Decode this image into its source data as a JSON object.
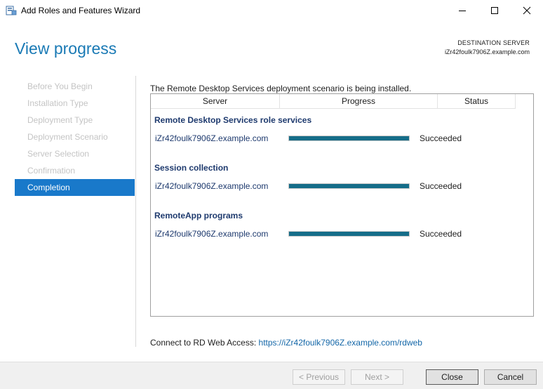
{
  "window": {
    "title": "Add Roles and Features Wizard",
    "icon": "server-manager-icon"
  },
  "header": {
    "title": "View progress",
    "destination_label": "DESTINATION SERVER",
    "destination_server": "iZr42foulk7906Z.example.com"
  },
  "nav": {
    "items": [
      {
        "label": "Before You Begin",
        "state": "disabled"
      },
      {
        "label": "Installation Type",
        "state": "disabled"
      },
      {
        "label": "Deployment Type",
        "state": "disabled"
      },
      {
        "label": "Deployment Scenario",
        "state": "disabled"
      },
      {
        "label": "Server Selection",
        "state": "disabled"
      },
      {
        "label": "Confirmation",
        "state": "disabled"
      },
      {
        "label": "Completion",
        "state": "active"
      }
    ]
  },
  "main": {
    "intro": "The Remote Desktop Services deployment scenario is being installed.",
    "columns": [
      "Server",
      "Progress",
      "Status"
    ],
    "groups": [
      {
        "title": "Remote Desktop Services role services",
        "rows": [
          {
            "server": "iZr42foulk7906Z.example.com",
            "progress": 1.0,
            "status": "Succeeded"
          }
        ]
      },
      {
        "title": "Session collection",
        "rows": [
          {
            "server": "iZr42foulk7906Z.example.com",
            "progress": 1.0,
            "status": "Succeeded"
          }
        ]
      },
      {
        "title": "RemoteApp programs",
        "rows": [
          {
            "server": "iZr42foulk7906Z.example.com",
            "progress": 1.0,
            "status": "Succeeded"
          }
        ]
      }
    ],
    "connect_label": "Connect to RD Web Access:",
    "connect_link": "https://iZr42foulk7906Z.example.com/rdweb"
  },
  "footer": {
    "previous": "< Previous",
    "next": "Next >",
    "close": "Close",
    "cancel": "Cancel"
  },
  "colors": {
    "accent": "#1979ca",
    "progress_fill": "#156d89",
    "title": "#1a7ab5"
  }
}
